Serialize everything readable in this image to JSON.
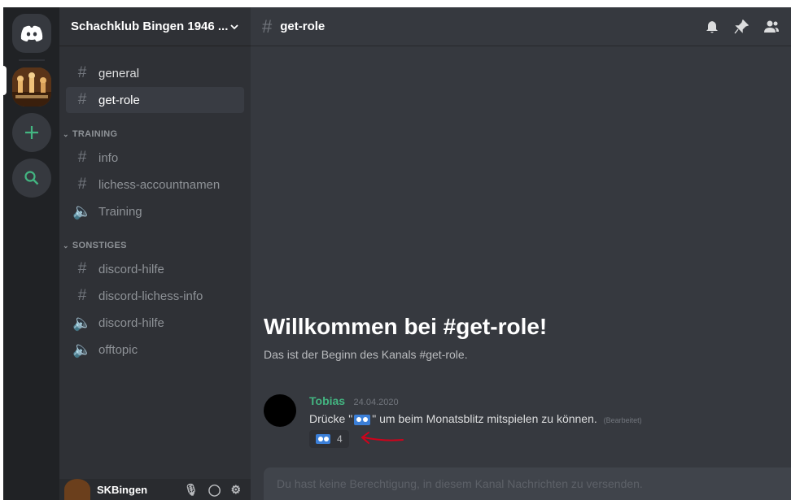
{
  "server": {
    "name": "Schachklub Bingen 1946 ..."
  },
  "channels_top": [
    {
      "label": "general",
      "type": "text",
      "bright": true
    },
    {
      "label": "get-role",
      "type": "rules",
      "active": true
    }
  ],
  "categories": [
    {
      "label": "TRAINING",
      "channels": [
        {
          "label": "info",
          "type": "rules"
        },
        {
          "label": "lichess-accountnamen",
          "type": "rules"
        },
        {
          "label": "Training",
          "type": "voice"
        }
      ]
    },
    {
      "label": "SONSTIGES",
      "channels": [
        {
          "label": "discord-hilfe",
          "type": "text"
        },
        {
          "label": "discord-lichess-info",
          "type": "text"
        },
        {
          "label": "discord-hilfe",
          "type": "voice"
        },
        {
          "label": "offtopic",
          "type": "voice"
        }
      ]
    }
  ],
  "user": {
    "name": "SKBingen"
  },
  "channel_header": {
    "title": "get-role"
  },
  "welcome": {
    "title": "Willkommen bei #get-role!",
    "subtitle": "Das ist der Beginn des Kanals #get-role."
  },
  "message": {
    "author": "Tobias",
    "timestamp": "24.04.2020",
    "text_before": "Drücke \"",
    "text_after": "\" um beim Monatsblitz mitspielen zu können.",
    "edited": "(Bearbeitet)",
    "reaction_count": "4"
  },
  "composer": {
    "placeholder": "Du hast keine Berechtigung, in diesem Kanal Nachrichten zu versenden."
  },
  "colors": {
    "annotation_arrow": "#d0021b",
    "author": "#43b581",
    "accent": "#3b7fd8"
  }
}
